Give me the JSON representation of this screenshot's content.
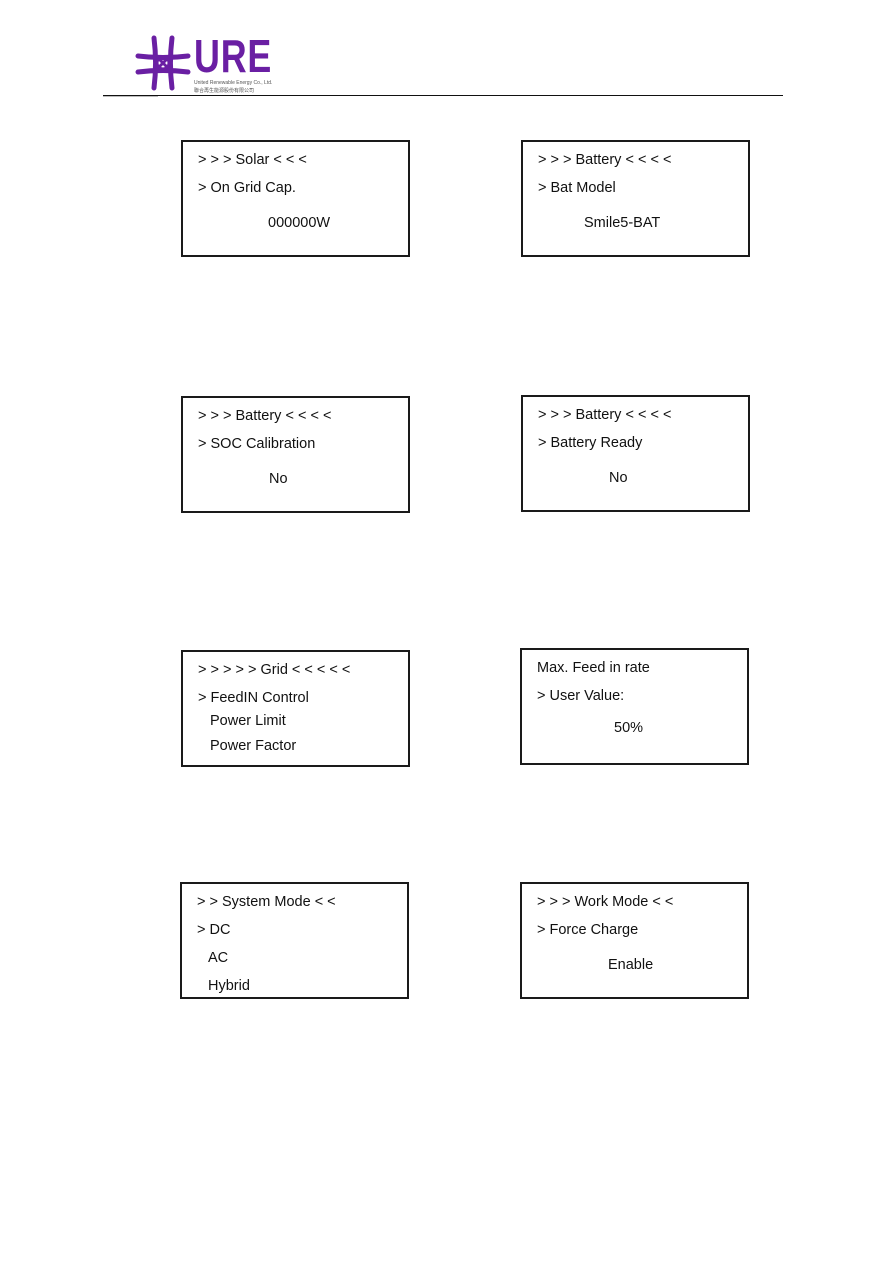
{
  "header": {
    "logo_text": "URE",
    "logo_subtitle_en": "United Renewable Energy Co., Ltd.",
    "logo_subtitle_zh": "聯合再生能源股份有限公司",
    "brand_color": "#6a1fa3"
  },
  "screens": [
    {
      "left_marker": "> > >",
      "title": "Solar",
      "right_marker": "< < <",
      "lines": [
        "> On Grid Cap."
      ],
      "value": "000000W"
    },
    {
      "left_marker": "> > >",
      "title": "Battery",
      "right_marker": "< < < <",
      "lines": [
        "> Bat Model"
      ],
      "value": "Smile5-BAT"
    },
    {
      "left_marker": "> > >",
      "title": "Battery",
      "right_marker": "< < < <",
      "lines": [
        "> SOC Calibration"
      ],
      "value": "No"
    },
    {
      "left_marker": "> > >",
      "title": "Battery",
      "right_marker": "< < < <",
      "lines": [
        "> Battery Ready"
      ],
      "value": "No"
    },
    {
      "left_marker": "> > > > >",
      "title": "Grid",
      "right_marker": "< < < < <",
      "lines": [
        "> FeedIN Control",
        "Power Limit",
        "Power Factor"
      ]
    },
    {
      "heading": "Max. Feed in rate",
      "lines": [
        "> User Value:"
      ],
      "value": "50%"
    },
    {
      "left_marker": "> >",
      "title": "System Mode",
      "right_marker": "< <",
      "lines": [
        "> DC",
        "AC",
        "Hybrid"
      ]
    },
    {
      "left_marker": "> > >",
      "title": "Work Mode",
      "right_marker": "< <",
      "lines": [
        "> Force Charge"
      ],
      "value": "Enable"
    }
  ]
}
